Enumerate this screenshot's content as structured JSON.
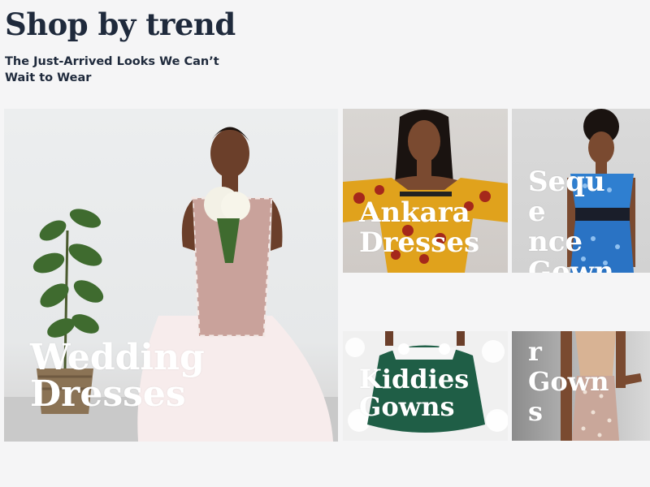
{
  "header": {
    "title": "Shop by trend",
    "subtitle": "The Just-Arrived Looks We Can’t Wait to Wear"
  },
  "trends": [
    {
      "label": "Wedding\nDresses"
    },
    {
      "label": "Ankara\nDresses"
    },
    {
      "label": "Seque\nnce\nGown"
    },
    {
      "label": "Kiddies\nGowns"
    },
    {
      "label": "Dinne\nr\nGown\ns"
    }
  ]
}
